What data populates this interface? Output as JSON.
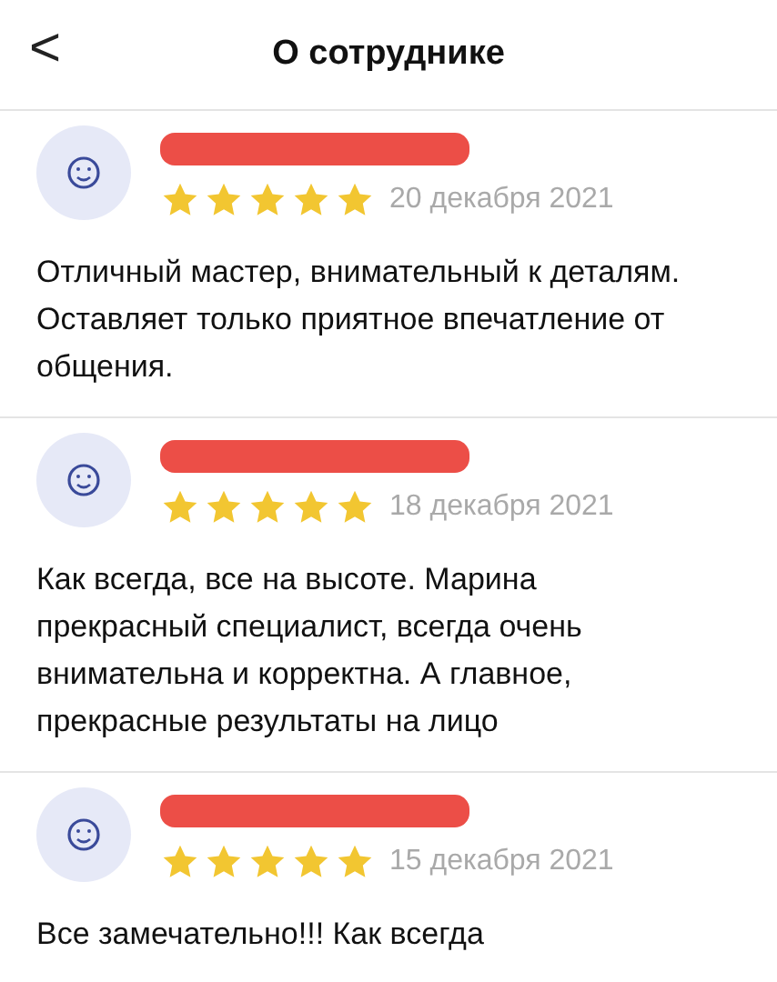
{
  "header": {
    "back_icon": "<",
    "title": "О сотруднике"
  },
  "reviews": [
    {
      "stars": 5,
      "date": "20 декабря 2021",
      "text": "Отличный мастер, внимательный к деталям. Оставляет только приятное впечатление от общения."
    },
    {
      "stars": 5,
      "date": "18 декабря 2021",
      "text": "Как всегда, все на высоте. Марина прекрасный специалист, всегда очень внимательна и корректна. А главное, прекрасные результаты на лицо"
    },
    {
      "stars": 5,
      "date": "15 декабря 2021",
      "text": "Все замечательно!!! Как всегда"
    }
  ]
}
